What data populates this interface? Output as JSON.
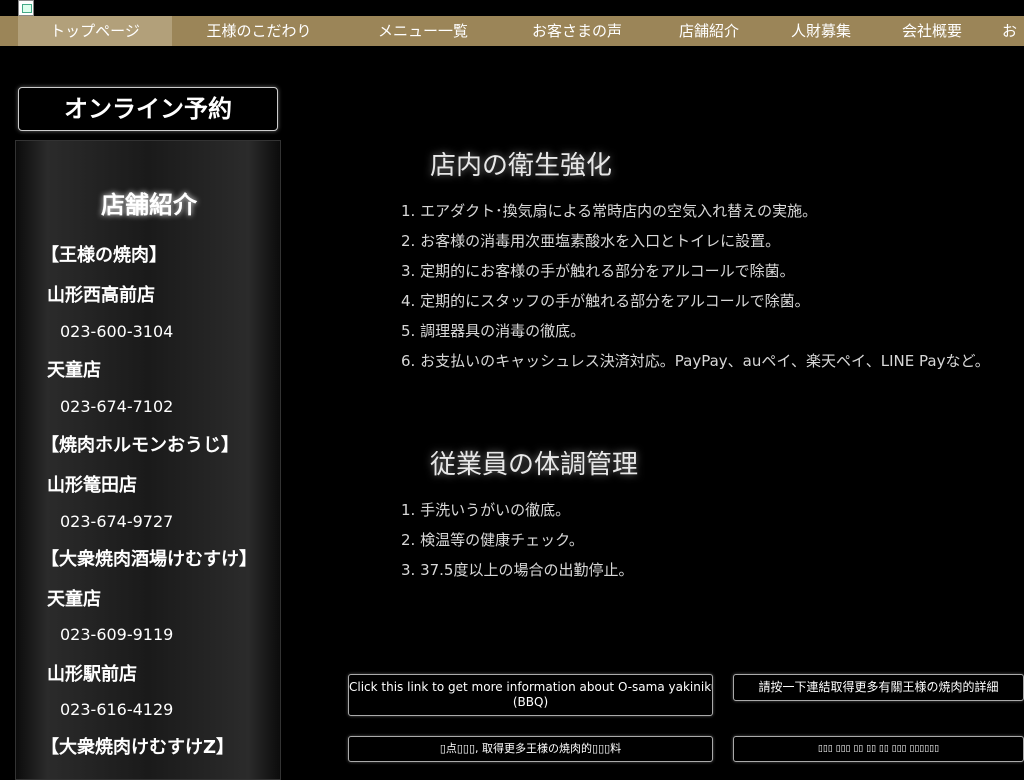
{
  "nav": {
    "items": [
      "トップページ",
      "王様のこだわり",
      "メニュー一覧",
      "お客さまの声",
      "店舗紹介",
      "人財募集",
      "会社概要",
      "お"
    ]
  },
  "sidebar": {
    "reserve_label": "オンライン予約",
    "panel_title": "店舗紹介",
    "entries": [
      "【王様の焼肉】",
      "山形西高前店",
      "023-600-3104",
      "天童店",
      "023-674-7102",
      "【焼肉ホルモンおうじ】",
      "山形篭田店",
      "023-674-9727",
      "【大衆焼肉酒場けむすけ】",
      "天童店",
      "023-609-9119",
      "山形駅前店",
      "023-616-4129",
      "【大衆焼肉けむすけZ】"
    ]
  },
  "main": {
    "section1": {
      "title": "店内の衛生強化",
      "items": [
        "1. エアダクト･換気扇による常時店内の空気入れ替えの実施。",
        "2. お客様の消毒用次亜塩素酸水を入口とトイレに設置。",
        "3. 定期的にお客様の手が触れる部分をアルコールで除菌。",
        "4. 定期的にスタッフの手が触れる部分をアルコールで除菌。",
        "5. 調理器具の消毒の徹底。",
        "6. お支払いのキャッシュレス決済対応。PayPay、auペイ、楽天ペイ、LINE Payなど。"
      ]
    },
    "section2": {
      "title": "従業員の体調管理",
      "items": [
        "1. 手洗いうがいの徹底。",
        "2. 検温等の健康チェック。",
        "3. 37.5度以上の場合の出勤停止。"
      ]
    }
  },
  "links": {
    "english_1": "Click this link to get more information about O-sama yakiniku",
    "english_2": "(BBQ)",
    "traditional_chinese": "請按一下連結取得更多有關王様の焼肉的詳細",
    "simplified_chinese": "▯点▯▯▯, 取得更多王様の焼肉的▯▯▯料",
    "other_language": "▯▯▯ ▯▯▯ ▯▯ ▯▯ ▯▯ ▯▯▯ ▯▯▯▯▯▯"
  }
}
